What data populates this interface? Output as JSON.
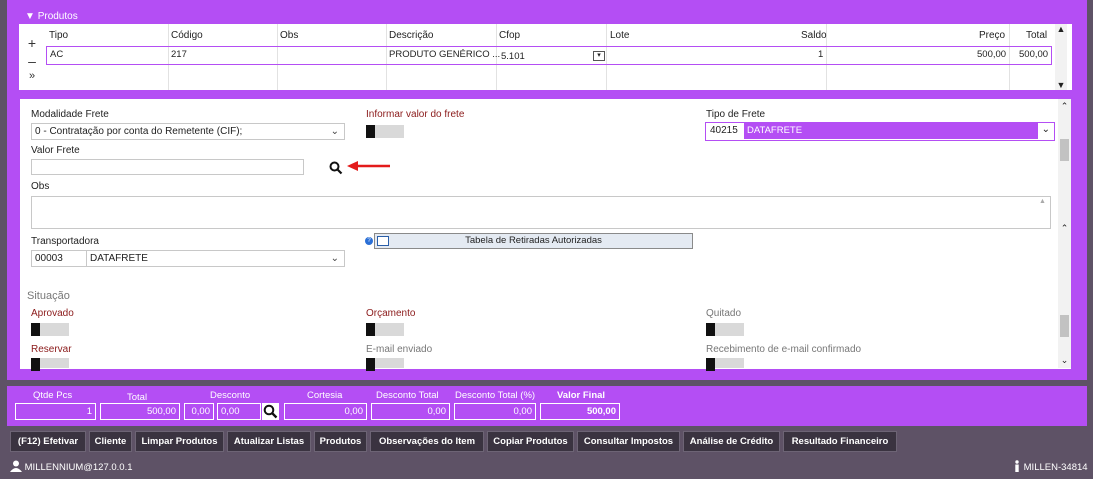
{
  "produtos": {
    "header": "Produtos",
    "side_buttons": [
      "+",
      "–",
      "»"
    ],
    "columns": [
      "Tipo",
      "Código",
      "Obs",
      "Descrição",
      "Cfop",
      "Lote",
      "Saldo",
      "Preço",
      "Total"
    ],
    "rows": [
      {
        "tipo": "AC",
        "codigo": "217",
        "obs": "",
        "descricao": "PRODUTO GENÉRICO ...",
        "cfop": "5.101",
        "lote": "",
        "saldo": "1",
        "preco": "500,00",
        "total": "500,00"
      }
    ]
  },
  "form": {
    "modalidade_frete": {
      "label": "Modalidade Frete",
      "value": "0 - Contratação por conta do Remetente (CIF);"
    },
    "informar_valor_frete": {
      "label": "Informar valor do frete"
    },
    "tipo_frete": {
      "label": "Tipo de Frete",
      "code": "40215",
      "value": "DATAFRETE"
    },
    "valor_frete": {
      "label": "Valor Frete",
      "value": ""
    },
    "obs": {
      "label": "Obs",
      "value": ""
    },
    "transportadora": {
      "label": "Transportadora",
      "code": "00003",
      "value": "DATAFRETE"
    },
    "tabela_button": "Tabela de Retiradas Autorizadas",
    "situacao": {
      "title": "Situação",
      "aprovado": "Aprovado",
      "orcamento": "Orçamento",
      "quitado": "Quitado",
      "reservar": "Reservar",
      "email_enviado": "E-mail enviado",
      "recebimento": "Recebimento de e-mail confirmado"
    }
  },
  "totals": {
    "qtde_label": "Qtde Pcs",
    "qtde_value": "1",
    "total_label": "Total",
    "total_value": "500,00",
    "desconto_label": "Desconto",
    "desconto_pct": "0,00",
    "desconto_value": "0,00",
    "cortesia_label": "Cortesia",
    "cortesia_value": "0,00",
    "desconto_total_label": "Desconto Total",
    "desconto_total_value": "0,00",
    "desconto_total_pct_label": "Desconto Total (%)",
    "desconto_total_pct_value": "0,00",
    "valor_final_label": "Valor Final",
    "valor_final_value": "500,00"
  },
  "buttons": [
    "(F12) Efetivar",
    "Cliente",
    "Limpar Produtos",
    "Atualizar Listas",
    "Produtos",
    "Observações do Item",
    "Copiar Produtos",
    "Consultar Impostos",
    "Análise de Crédito",
    "Resultado Financeiro"
  ],
  "status": {
    "user": "MILLENNIUM@127.0.0.1",
    "instance": "MILLEN-34814"
  },
  "colors": {
    "accent": "#b44ef4",
    "dark": "#5e5266",
    "label_red": "#8b1a1a"
  }
}
